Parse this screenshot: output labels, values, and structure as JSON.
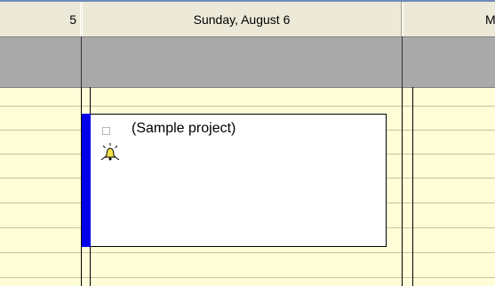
{
  "header": {
    "prev_day_fragment": "5",
    "day_label": "Sunday, August 6",
    "next_day_fragment": "M"
  },
  "appointment": {
    "title": "(Sample project)",
    "bar_color": "#0000ee",
    "icons": [
      "checkbox-icon",
      "reminder-bell-icon"
    ]
  },
  "colors": {
    "grid_background": "#fefdd7",
    "allday_band": "#a9a9a9",
    "header_background": "#ece9d8"
  }
}
